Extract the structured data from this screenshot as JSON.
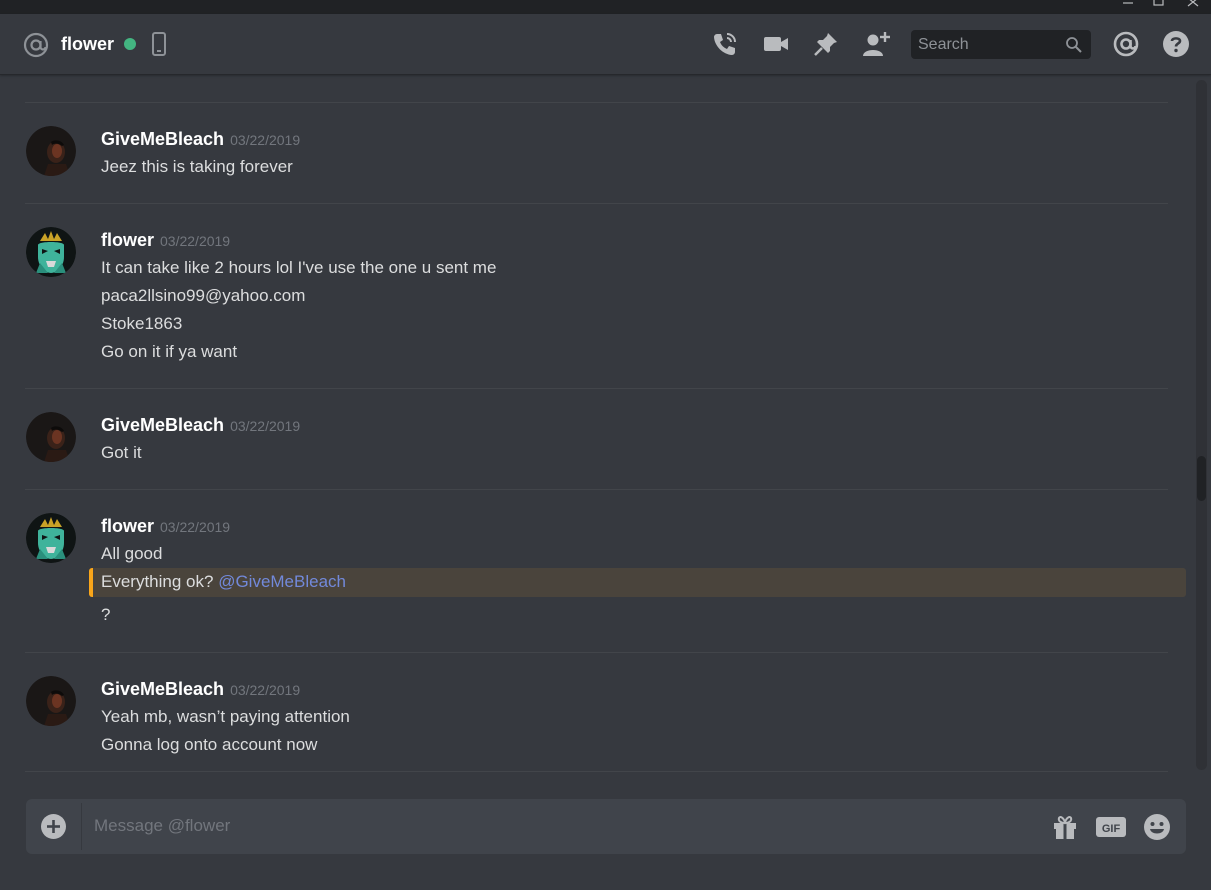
{
  "header": {
    "channel_name": "flower",
    "search_placeholder": "Search"
  },
  "messages": [
    {
      "author": "GiveMeBleach",
      "timestamp": "03/22/2019",
      "lines": [
        "Jeez this is taking forever"
      ]
    },
    {
      "author": "flower",
      "timestamp": "03/22/2019",
      "lines": [
        "It can take like 2 hours lol I've use the one u sent me",
        "paca2llsino99@yahoo.com",
        "Stoke1863",
        "Go on it if ya want"
      ]
    },
    {
      "author": "GiveMeBleach",
      "timestamp": "03/22/2019",
      "lines": [
        "Got it"
      ]
    },
    {
      "author": "flower",
      "timestamp": "03/22/2019",
      "lines": [
        "All good",
        "Everything ok?",
        "?"
      ],
      "mention": "@GiveMeBleach"
    },
    {
      "author": "GiveMeBleach",
      "timestamp": "03/22/2019",
      "lines": [
        "Yeah mb, wasn’t paying attention",
        "Gonna log onto account now"
      ]
    }
  ],
  "composer": {
    "placeholder": "Message @flower",
    "gif_label": "GIF"
  },
  "colors": {
    "background": "#36393f",
    "status_online": "#43b581",
    "mention_highlight": "#faa61a",
    "mention_text": "#7289da"
  },
  "icons": [
    "at-icon",
    "mobile-icon",
    "call-icon",
    "video-icon",
    "pin-icon",
    "add-friend-icon",
    "search-icon",
    "mentions-icon",
    "help-icon",
    "add-attachment-icon",
    "gift-icon",
    "gif-icon",
    "emoji-icon"
  ]
}
